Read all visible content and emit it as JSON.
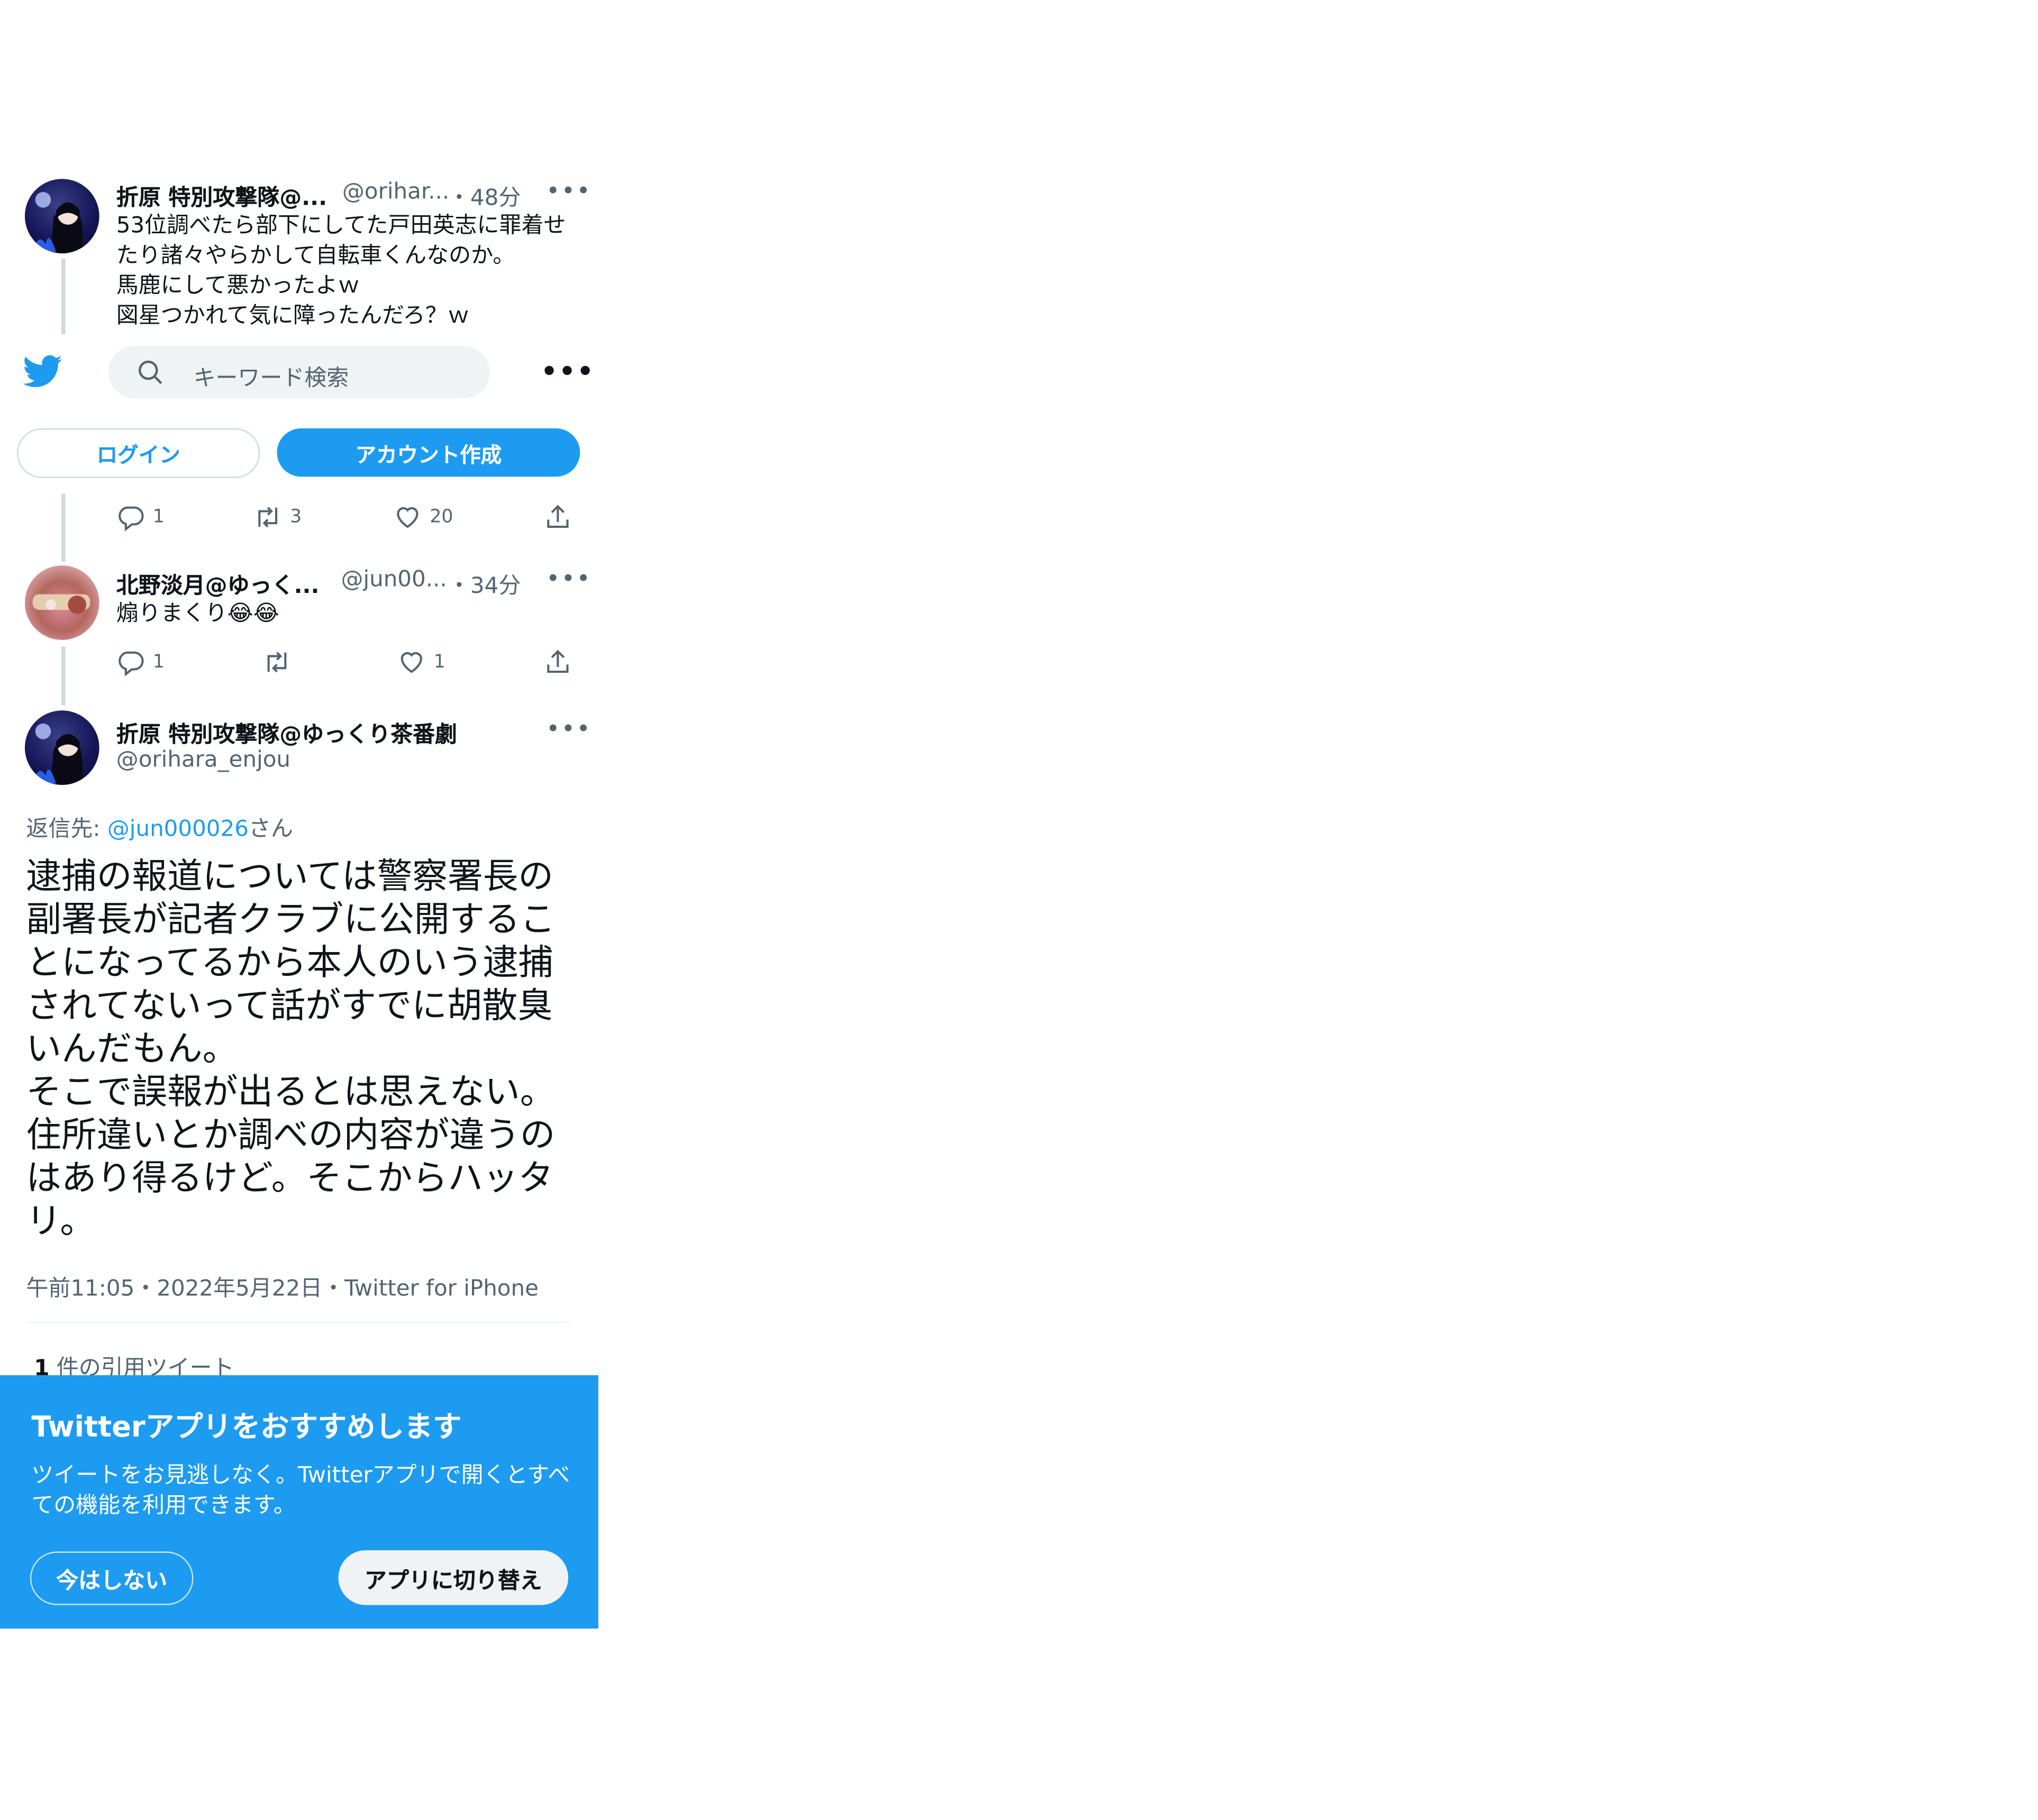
{
  "colors": {
    "accent": "#1d9bf0",
    "text": "#0f1419",
    "muted": "#536471",
    "border": "#cfd9de"
  },
  "header": {
    "search_placeholder": "キーワード検索",
    "login_label": "ログイン",
    "signup_label": "アカウント作成"
  },
  "tweets": [
    {
      "name": "折原 特別攻撃隊@...",
      "handle": "@orihar...",
      "time": "・48分",
      "text": "53位調べたら部下にしてた戸田英志に罪着せたり諸々やらかして自転車くんなのか。\n馬鹿にして悪かったよｗ\n図星つかれて気に障ったんだろ？ｗ",
      "reply_count": "1",
      "retweet_count": "3",
      "like_count": "20"
    },
    {
      "name": "北野淡月@ゆっく...",
      "handle": "@jun00...",
      "time": "・34分",
      "text": "煽りまくり😂😂",
      "reply_count": "1",
      "retweet_count": "",
      "like_count": "1"
    }
  ],
  "main_tweet": {
    "name": "折原 特別攻撃隊@ゆっくり茶番劇",
    "handle": "@orihara_enjou",
    "reply_prefix": "返信先: ",
    "reply_to": "@jun000026",
    "reply_suffix": "さん",
    "text": "逮捕の報道については警察署長の副署長が記者クラブに公開することになってるから本人のいう逮捕されてないって話がすでに胡散臭いんだもん。\nそこで誤報が出るとは思えない。\n住所違いとか調べの内容が違うのはあり得るけど。そこからハッタリ。",
    "meta": "午前11:05・2022年5月22日・Twitter for iPhone",
    "quote_count": "1",
    "quote_label": "件の引用ツイート"
  },
  "app_banner": {
    "title": "Twitterアプリをおすすめします",
    "body": "ツイートをお見逃しなく。Twitterアプリで開くとすべての機能を利用できます。",
    "dismiss_label": "今はしない",
    "switch_label": "アプリに切り替え"
  }
}
